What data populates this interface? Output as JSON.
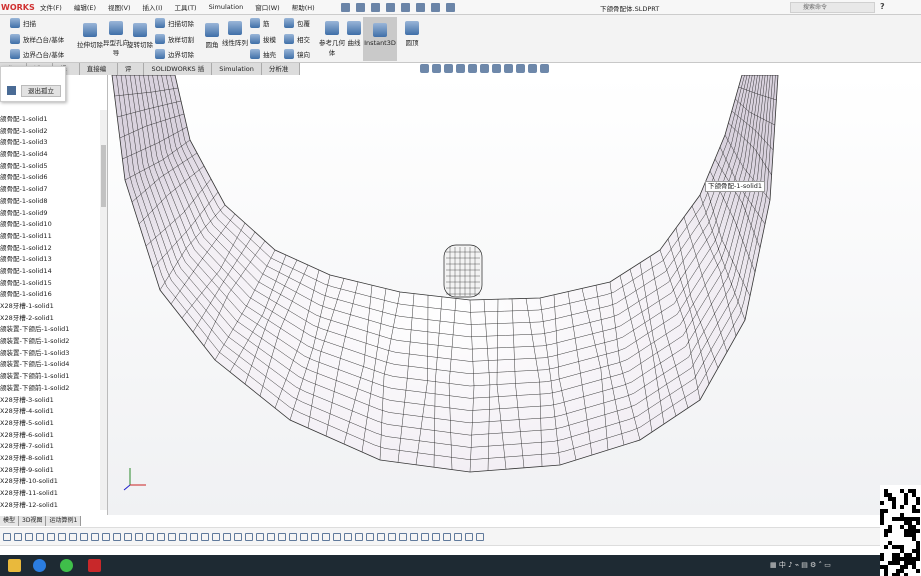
{
  "app": {
    "logo": "WORKS",
    "title": "下颌骨配体.SLDPRT",
    "search_placeholder": "搜索命令",
    "help": "?"
  },
  "menu": [
    "文件(F)",
    "编辑(E)",
    "视图(V)",
    "插入(I)",
    "工具(T)",
    "Simulation",
    "窗口(W)",
    "帮助(H)"
  ],
  "ribbon": {
    "sweep": "扫描",
    "loft_boss": "放样凸台/基体",
    "boundary_boss": "边界凸台/基体",
    "extrude_cut": "拉伸切除",
    "hole_wizard": "异型孔向导",
    "revolve_cut": "旋转切除",
    "sweep_cut": "扫描切除",
    "loft_cut": "放样切割",
    "boundary_cut": "边界切除",
    "fillet": "圆角",
    "linear_pattern": "线性阵列",
    "rib": "筋",
    "draft": "拔模",
    "shell": "抽壳",
    "wrap": "包覆",
    "intersect": "相交",
    "mirror": "镜向",
    "ref_geometry": "参考几何体",
    "curves": "曲线",
    "instant3d": "Instant3D",
    "dome": "圆顶"
  },
  "tabs": [
    "曲面",
    "钣金",
    "焊件",
    "直接编辑",
    "评估",
    "SOLIDWORKS 插件",
    "Simulation",
    "分析准备"
  ],
  "popup": {
    "exit_isolate": "退出孤立"
  },
  "tree": [
    "颌骨配-1-solid1",
    "颌骨配-1-solid2",
    "颌骨配-1-solid3",
    "颌骨配-1-solid4",
    "颌骨配-1-solid5",
    "颌骨配-1-solid6",
    "颌骨配-1-solid7",
    "颌骨配-1-solid8",
    "颌骨配-1-solid9",
    "颌骨配-1-solid10",
    "颌骨配-1-solid11",
    "颌骨配-1-solid12",
    "颌骨配-1-solid13",
    "颌骨配-1-solid14",
    "颌骨配-1-solid15",
    "颌骨配-1-solid16",
    "X28牙槽-1-solid1",
    "X28牙槽-2-solid1",
    "颌装置-下颌后-1-solid1",
    "颌装置-下颌后-1-solid2",
    "颌装置-下颌后-1-solid3",
    "颌装置-下颌后-1-solid4",
    "颌装置-下颌前-1-solid1",
    "颌装置-下颌前-1-solid2",
    "X28牙槽-3-solid1",
    "X28牙槽-4-solid1",
    "X28牙槽-5-solid1",
    "X28牙槽-6-solid1",
    "X28牙槽-7-solid1",
    "X28牙槽-8-solid1",
    "X28牙槽-9-solid1",
    "X28牙槽-10-solid1",
    "X28牙槽-11-solid1",
    "X28牙槽-12-solid1"
  ],
  "hover_label": "下颌骨配-1-solid1",
  "bottom_tabs": [
    "模型",
    "3D视图",
    "运动算例1"
  ],
  "colors": {
    "logo": "#d03030",
    "taskbar": "#1e2a33",
    "accent": "#3f6fa8"
  }
}
